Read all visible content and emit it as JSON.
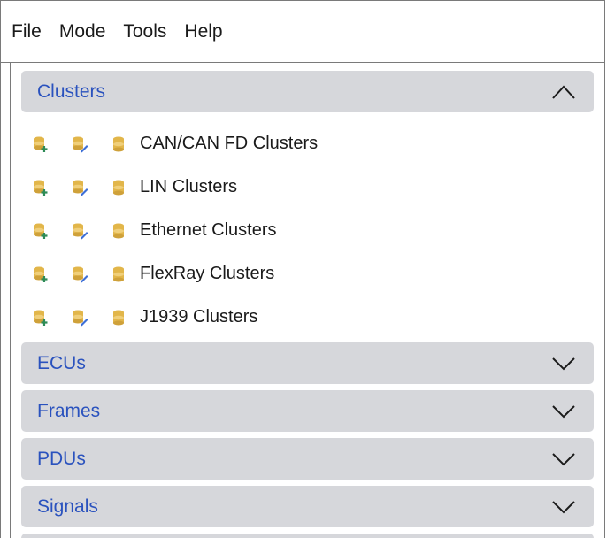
{
  "menubar": {
    "items": [
      "File",
      "Mode",
      "Tools",
      "Help"
    ]
  },
  "sections": {
    "clusters": {
      "title": "Clusters",
      "expanded": true,
      "items": [
        {
          "label": "CAN/CAN FD Clusters"
        },
        {
          "label": "LIN Clusters"
        },
        {
          "label": "Ethernet Clusters"
        },
        {
          "label": "FlexRay Clusters"
        },
        {
          "label": "J1939 Clusters"
        }
      ]
    },
    "ecus": {
      "title": "ECUs",
      "expanded": false
    },
    "frames": {
      "title": "Frames",
      "expanded": false
    },
    "pdus": {
      "title": "PDUs",
      "expanded": false
    },
    "signals": {
      "title": "Signals",
      "expanded": false
    }
  },
  "icons": {
    "row_icons": [
      "database-add-icon",
      "database-edit-icon",
      "database-icon"
    ],
    "expanded": "chevron-up-icon",
    "collapsed": "chevron-down-icon"
  },
  "colors": {
    "section_title": "#2a52be",
    "section_bg": "#d6d7db",
    "db_gold": "#e2b64a",
    "add_green": "#2e8b57",
    "edit_blue": "#3d6fd6"
  }
}
